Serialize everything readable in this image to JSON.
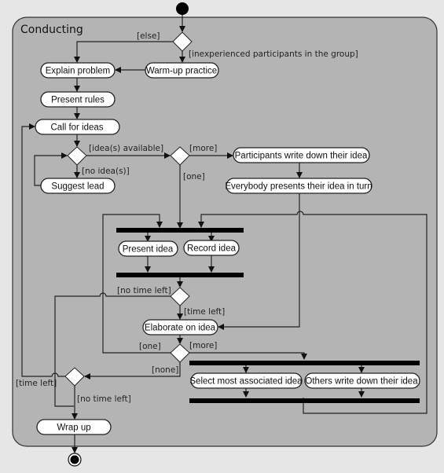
{
  "diagram": {
    "type": "UML activity diagram",
    "region_title": "Conducting",
    "actions": {
      "explain_problem": "Explain problem",
      "warm_up": "Warm-up practice",
      "present_rules": "Present rules",
      "call_for_ideas": "Call for ideas",
      "suggest_lead": "Suggest lead",
      "participants_write": "Participants write down their idea",
      "everybody_presents": "Everybody presents their idea in turn",
      "present_idea": "Present idea",
      "record_idea": "Record idea",
      "elaborate": "Elaborate on idea",
      "select_most": "Select most associated idea",
      "others_write": "Others write down their idea",
      "wrap_up": "Wrap up"
    },
    "guards": {
      "else": "[else]",
      "inexperienced": "[inexperienced participants in the group]",
      "ideas_available": "[idea(s) available]",
      "no_ideas": "[no idea(s)]",
      "more_1": "[more]",
      "one_1": "[one]",
      "no_time_left_1": "[no time left]",
      "time_left_1": "[time left]",
      "one_2": "[one]",
      "more_2": "[more]",
      "none": "[none]",
      "time_left_2": "[time left]",
      "no_time_left_2": "[no time left]"
    },
    "colors": {
      "background": "#e6e6e6",
      "region_fill": "#b4b4b4",
      "node_fill": "#ffffff",
      "line": "#222222"
    }
  }
}
